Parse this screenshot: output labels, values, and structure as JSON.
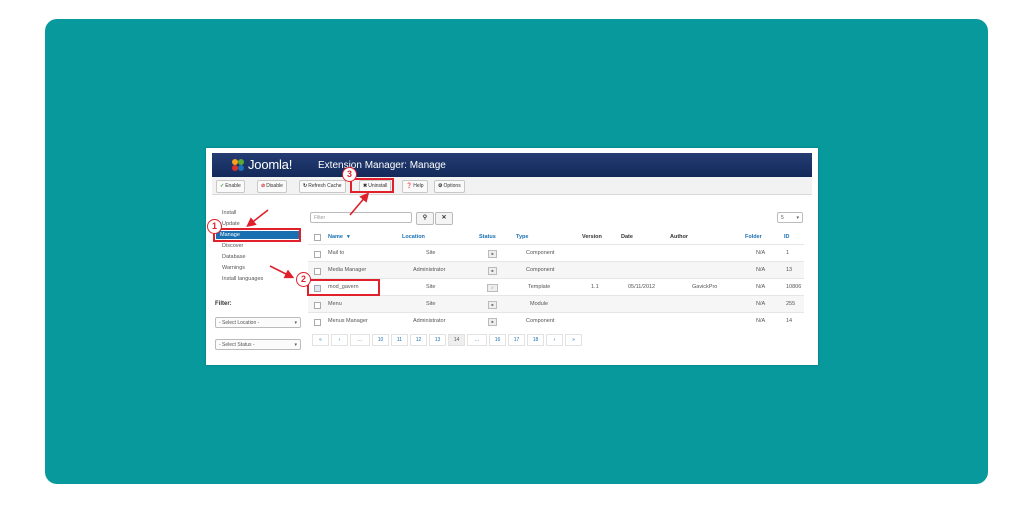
{
  "app": {
    "logo_text": "Joomla!",
    "title": "Extension Manager: Manage"
  },
  "toolbar": {
    "enable": "Enable",
    "disable": "Disable",
    "refresh": "Refresh Cache",
    "uninstall": "Uninstall",
    "help": "Help",
    "options": "Options"
  },
  "sidebar": {
    "items": [
      "Install",
      "Update",
      "Manage",
      "Discover",
      "Database",
      "Warnings",
      "Install languages"
    ],
    "filter_label": "Filter:",
    "select_location": "- Select Location -",
    "select_status": "- Select Status -"
  },
  "search": {
    "placeholder": "Filter",
    "limit": "5"
  },
  "table": {
    "headers": [
      "Name",
      "Location",
      "Status",
      "Type",
      "Version",
      "Date",
      "Author",
      "Folder",
      "ID"
    ],
    "rows": [
      {
        "name": "Mail to",
        "location": "Site",
        "type": "Component",
        "version": "",
        "date": "",
        "author": "",
        "folder": "N/A",
        "id": "1"
      },
      {
        "name": "Media Manager",
        "location": "Administrator",
        "type": "Component",
        "version": "",
        "date": "",
        "author": "",
        "folder": "N/A",
        "id": "13"
      },
      {
        "name": "mod_gavern",
        "location": "Site",
        "type": "Template",
        "version": "1.1",
        "date": "05/11/2012",
        "author": "GavickPro",
        "folder": "N/A",
        "id": "10806"
      },
      {
        "name": "Menu",
        "location": "Site",
        "type": "Module",
        "version": "",
        "date": "",
        "author": "",
        "folder": "N/A",
        "id": "255"
      },
      {
        "name": "Menus Manager",
        "location": "Administrator",
        "type": "Component",
        "version": "",
        "date": "",
        "author": "",
        "folder": "N/A",
        "id": "14"
      }
    ]
  },
  "pagination": [
    "«",
    "‹",
    "...",
    "10",
    "11",
    "12",
    "13",
    "14",
    "...",
    "16",
    "17",
    "18",
    "›",
    "»"
  ],
  "annotations": [
    "1",
    "2",
    "3"
  ],
  "colors": {
    "background": "#07999b",
    "header": "#1b3467",
    "highlight": "#e0202a",
    "link": "#1a6fb0"
  }
}
